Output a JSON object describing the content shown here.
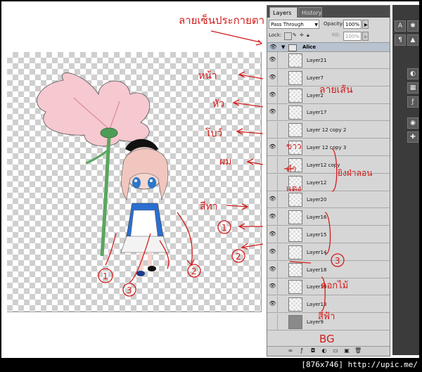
{
  "panel": {
    "tab_layers": "Layers",
    "tab_close": "×",
    "tab_history": "History",
    "blend_mode": "Pass Through",
    "opacity_label": "Opacity:",
    "opacity_value": "100%",
    "lock_label": "Lock:",
    "fill_label": "Fill:",
    "fill_value": "100%",
    "group_name": "Alice",
    "layers": [
      {
        "name": "Layer21",
        "visible": true
      },
      {
        "name": "Layer7",
        "visible": true
      },
      {
        "name": "Layer2",
        "visible": true
      },
      {
        "name": "Layer17",
        "visible": true
      },
      {
        "name": "Layer 12 copy 2",
        "visible": false
      },
      {
        "name": "Layer 12 copy 3",
        "visible": true
      },
      {
        "name": "Layer12 copy",
        "visible": false
      },
      {
        "name": "Layer12",
        "visible": false
      },
      {
        "name": "Layer20",
        "visible": true
      },
      {
        "name": "Layer16",
        "visible": true
      },
      {
        "name": "Layer15",
        "visible": true
      },
      {
        "name": "Layer14",
        "visible": true
      },
      {
        "name": "Layer18",
        "visible": true
      },
      {
        "name": "Layer19",
        "visible": true
      },
      {
        "name": "Layer13",
        "visible": true
      },
      {
        "name": "Layer9",
        "visible": false
      }
    ]
  },
  "annotations": {
    "top_note": "ลายเซ็นประกายตา",
    "face": "หน้า",
    "head": "หัว",
    "lineart": "ลายเส้น",
    "bow": "โบว์",
    "hair": "ผม",
    "eyes_white": "ขาว",
    "eyes_black": "ดำ",
    "eyes_red": "แดง",
    "eye_overlay": "ยิงฝ่าลอน",
    "dress_colour": "สีทา",
    "flower": "ดอกไม้",
    "sky": "สีฟ้า",
    "bg": "BG",
    "n1": "1",
    "n2": "2",
    "n3": "3"
  },
  "caption": "[876x746] http://upic.me/"
}
